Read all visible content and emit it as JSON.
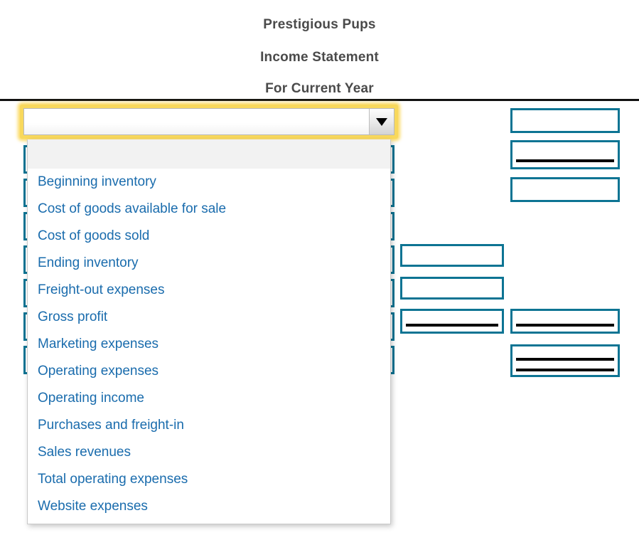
{
  "statement": {
    "company": "Prestigious Pups",
    "title": "Income Statement",
    "period": "For Current Year"
  },
  "combobox": {
    "value": "",
    "placeholder": "",
    "arrow_icon": "chevron-down-icon",
    "state": "open-focused"
  },
  "dropdown": {
    "options": [
      "",
      "Beginning inventory",
      "Cost of goods available for sale",
      "Cost of goods sold",
      "Ending inventory",
      "Freight-out expenses",
      "Gross profit",
      "Marketing expenses",
      "Operating expenses",
      "Operating income",
      "Purchases and freight-in",
      "Sales revenues",
      "Total operating expenses",
      "Website expenses"
    ],
    "highlighted_index": 0
  },
  "label_selects": [
    {
      "value": ""
    },
    {
      "value": ""
    },
    {
      "value": ""
    },
    {
      "value": ""
    },
    {
      "value": ""
    },
    {
      "value": ""
    },
    {
      "value": ""
    },
    {
      "value": ""
    }
  ],
  "middle_column": [
    {
      "value": "",
      "rule": "none"
    },
    {
      "value": "",
      "rule": "none"
    },
    {
      "value": "",
      "rule": "single"
    }
  ],
  "right_column": [
    {
      "value": "",
      "rule": "none"
    },
    {
      "value": "",
      "rule": "single"
    },
    {
      "value": "",
      "rule": "none"
    },
    {
      "value": "",
      "rule": "single"
    },
    {
      "value": "",
      "rule": "double"
    }
  ],
  "colors": {
    "box_border": "#0d7493",
    "option_text": "#1a6cad",
    "heading_text": "#4a4a4a",
    "focus_glow": "#f8d85c",
    "rule_black": "#000000",
    "highlight_row": "#f2f2f2"
  }
}
